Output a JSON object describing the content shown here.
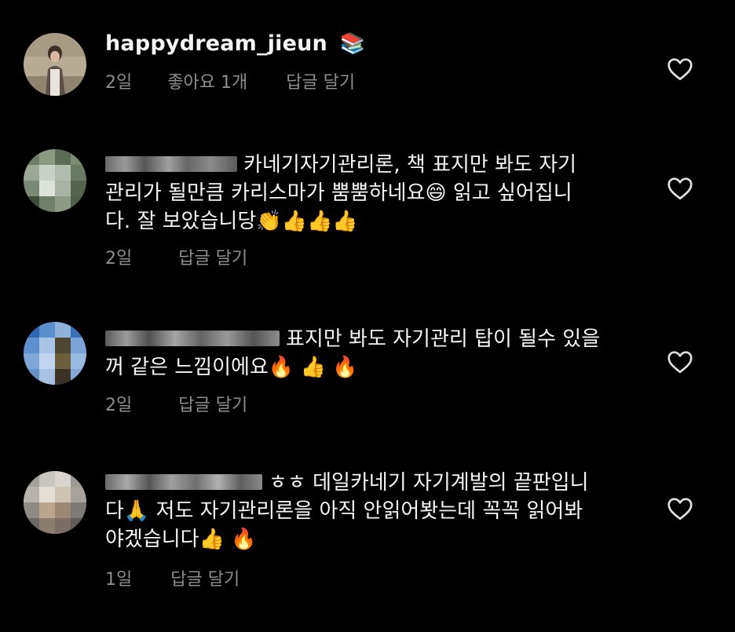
{
  "comments": [
    {
      "username": "happydream_jieun",
      "username_emoji": "📚",
      "text_line1": "",
      "text_line2": "",
      "text_line3": "",
      "time": "2일",
      "likes": "좋아요 1개",
      "reply": "답글 달기"
    },
    {
      "username": "",
      "text_line1": "카네기자기관리론,  책 표지만 봐도 자기",
      "text_line2": "관리가 될만큼 카리스마가 뿜뿜하네요😄   읽고 싶어집니",
      "text_line3": "다. 잘 보았습니당👏👍👍👍",
      "time": "2일",
      "reply": "답글 달기"
    },
    {
      "username": "",
      "text_line1": "표지만 봐도 자기관리 탑이 될수 있을",
      "text_line2": "꺼 같은 느낌이에요🔥 👍 🔥",
      "time": "2일",
      "reply": "답글 달기"
    },
    {
      "username": "",
      "text_line1": "ㅎㅎ 데일카네기 자기계발의 끝판입니",
      "text_line2": "다🙏  저도 자기관리론을 아직 안읽어봣는데 꼭꼭 읽어봐",
      "text_line3": "야겠습니다👍 🔥",
      "time": "1일",
      "reply": "답글 달기"
    }
  ],
  "icons": {
    "heart": "heart-outline-icon"
  },
  "colors": {
    "background": "#000000",
    "text": "#f5f5f5",
    "meta": "#8e8e8e"
  }
}
